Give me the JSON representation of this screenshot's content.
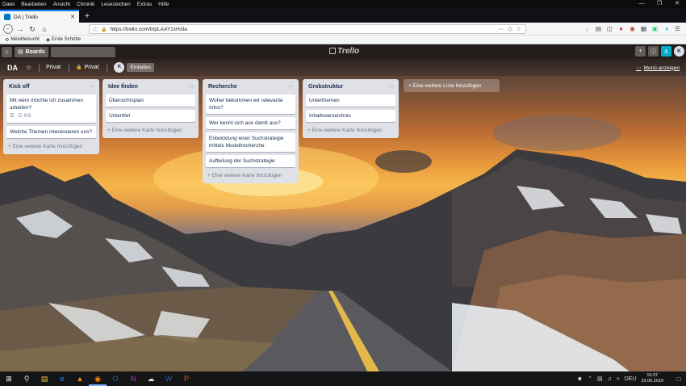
{
  "browser": {
    "menu": [
      "Datei",
      "Bearbeiten",
      "Ansicht",
      "Chronik",
      "Lesezeichen",
      "Extras",
      "Hilfe"
    ],
    "tab_title": "DA | Trello",
    "url": "https://trello.com/b/pLAAY1xH/da",
    "bookmarks": [
      "Meistbesucht",
      "Erste Schritte"
    ]
  },
  "trello_header": {
    "boards_label": "Boards",
    "logo_text": "Trello",
    "avatar_initial": "K"
  },
  "board": {
    "title": "DA",
    "visibility": "Privat",
    "team": "Privat",
    "member_initial": "K",
    "invite_label": "Einladen",
    "menu_label": "Menü anzeigen",
    "add_list_label": "+ Eine weitere Liste hinzufügen"
  },
  "lists": [
    {
      "title": "Kick off",
      "cards": [
        {
          "text": "Mit wem möchte ich zusammen arbeiten?",
          "checklist": "0/3"
        },
        {
          "text": "Welche Themen interessieren uns?"
        }
      ],
      "add_card_label": "+ Eine weitere Karte hinzufügen"
    },
    {
      "title": "Idee finden",
      "cards": [
        {
          "text": "Übersichtsplan"
        },
        {
          "text": "Untertitel"
        }
      ],
      "add_card_label": "+ Eine weitere Karte hinzufügen"
    },
    {
      "title": "Recherche",
      "cards": [
        {
          "text": "Woher bekommen wir relevante Infos?"
        },
        {
          "text": "Wer kennt sich aus damit aus?"
        },
        {
          "text": "Entwicklung einer Suchstrategie mittels Modellrecherche"
        },
        {
          "text": "Aufteilung der Suchstrategie"
        }
      ],
      "add_card_label": "+ Eine weitere Karte hinzufügen"
    },
    {
      "title": "Grobstruktur",
      "cards": [
        {
          "text": "Unterthemen"
        },
        {
          "text": "Inhaltsverzeichnis"
        }
      ],
      "add_card_label": "+ Eine weitere Karte hinzufügen"
    }
  ],
  "taskbar": {
    "language": "DEU",
    "time": "15:37",
    "date": "23.06.2019"
  }
}
